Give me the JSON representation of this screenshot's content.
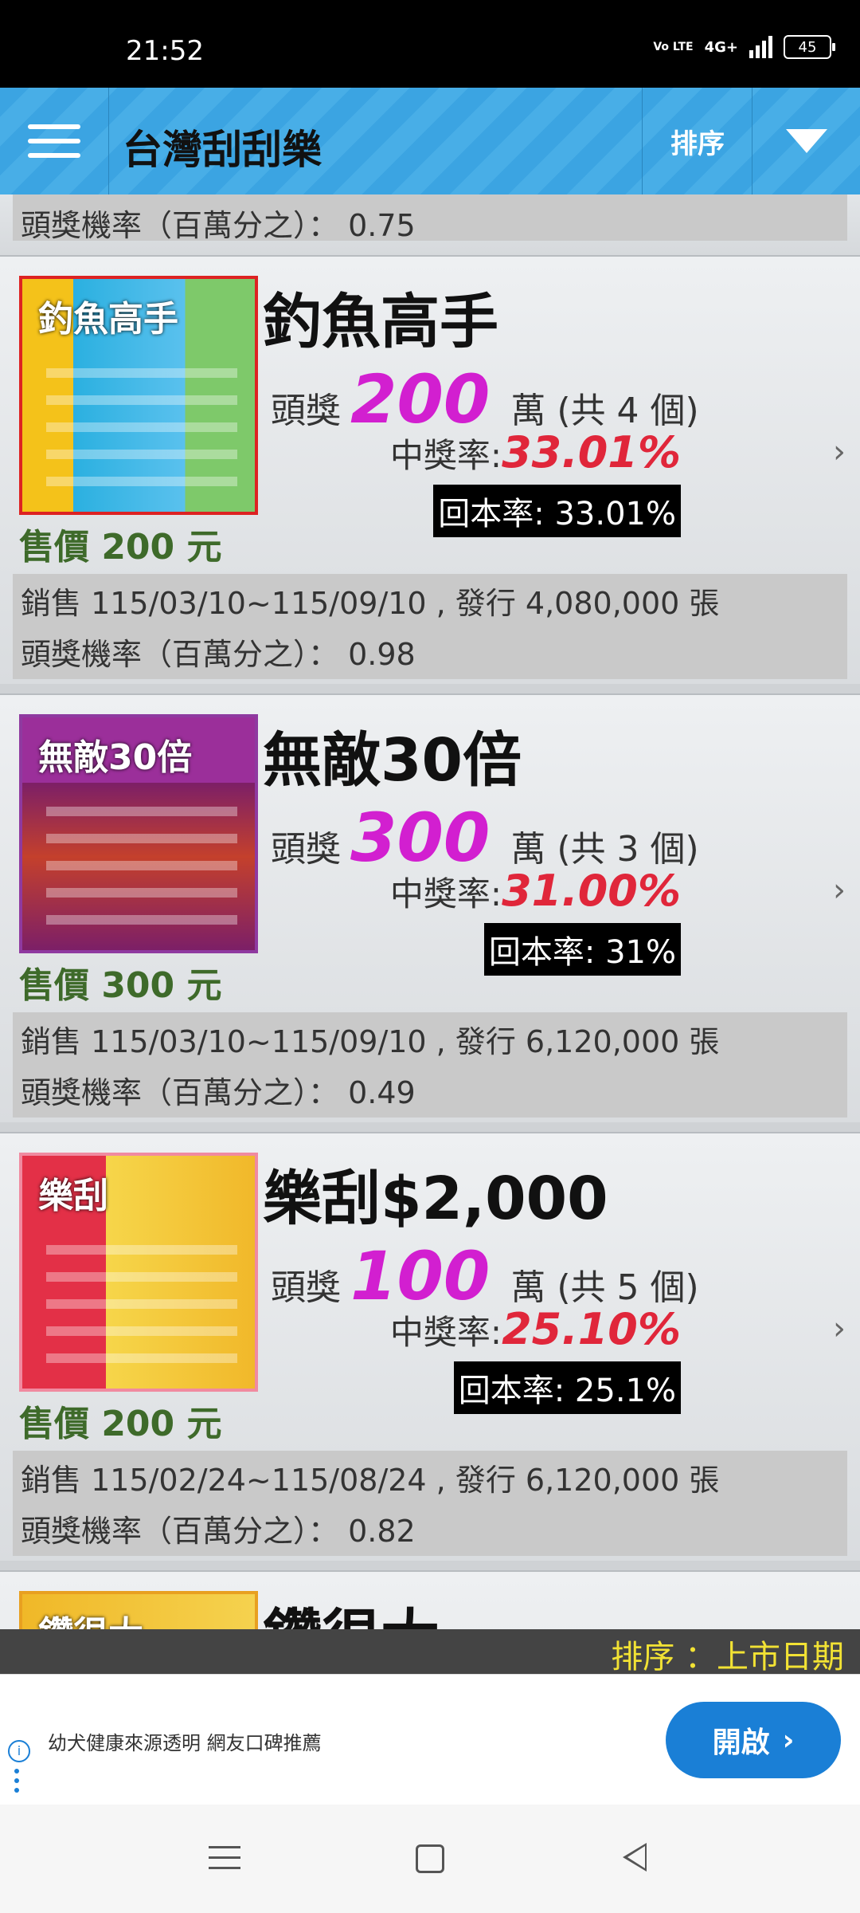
{
  "status_bar": {
    "time": "21:52",
    "volte": "Vo LTE",
    "network": "4G+",
    "battery": "45"
  },
  "app_bar": {
    "title": "台灣刮刮樂",
    "sort_label": "排序",
    "menu_icon": "hamburger-menu-icon",
    "filter_icon": "triangle-down-icon"
  },
  "partial_top": {
    "odds_text": "頭獎機率（百萬分之）： 0.75"
  },
  "tickets": [
    {
      "name": "釣魚高手",
      "prize_label": "頭獎",
      "prize_value": "200",
      "prize_unit": "萬 (共 4 個)",
      "win_rate_label": "中獎率:",
      "win_rate": "33.01%",
      "return_rate": "回本率: 33.01%",
      "price": "售價 200 元",
      "sales": "銷售 115/03/10~115/09/10 , 發行 4,080,000 張",
      "odds": "頭獎機率（百萬分之）： 0.98",
      "thumb_text": "釣魚高手"
    },
    {
      "name": "無敵30倍",
      "prize_label": "頭獎",
      "prize_value": "300",
      "prize_unit": "萬 (共 3 個)",
      "win_rate_label": "中獎率:",
      "win_rate": "31.00%",
      "return_rate": "回本率: 31%",
      "price": "售價 300 元",
      "sales": "銷售 115/03/10~115/09/10 , 發行 6,120,000 張",
      "odds": "頭獎機率（百萬分之）： 0.49",
      "thumb_text": "無敵30倍"
    },
    {
      "name": "樂刮$2,000",
      "prize_label": "頭獎",
      "prize_value": "100",
      "prize_unit": "萬 (共 5 個)",
      "win_rate_label": "中獎率:",
      "win_rate": "25.10%",
      "return_rate": "回本率: 25.1%",
      "price": "售價 200 元",
      "sales": "銷售 115/02/24~115/08/24 , 發行 6,120,000 張",
      "odds": "頭獎機率（百萬分之）： 0.82",
      "thumb_text": "樂刮"
    }
  ],
  "partial_bottom": {
    "name": "鑽很大",
    "thumb_text": "鑽很大"
  },
  "sort_strip": {
    "text": "排序 ：上市日期"
  },
  "ad": {
    "text": "幼犬健康來源透明 網友口碑推薦",
    "button_label": "開啟",
    "info_glyph": "i"
  },
  "colors": {
    "app_bar": "#3ba4e2",
    "prize_magenta": "#d21fd0",
    "win_rate_red": "#e0263a",
    "price_green": "#3e6a2a",
    "sort_yellow": "#f2e234",
    "ad_blue": "#1a7fd6"
  }
}
